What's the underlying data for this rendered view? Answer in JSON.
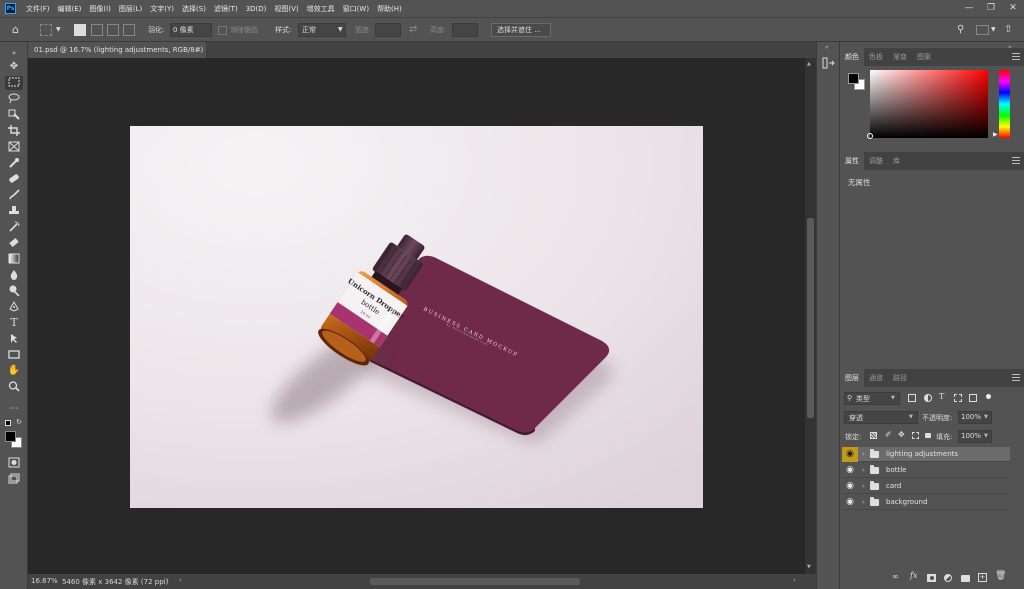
{
  "menubar": {
    "logo": "Ps",
    "items": [
      "文件(F)",
      "编辑(E)",
      "图像(I)",
      "图层(L)",
      "文字(Y)",
      "选择(S)",
      "滤镜(T)",
      "3D(D)",
      "视图(V)",
      "增效工具",
      "窗口(W)",
      "帮助(H)"
    ]
  },
  "options": {
    "feather_label": "羽化:",
    "feather_value": "0 像素",
    "antialias_label": "消除锯齿",
    "style_label": "样式:",
    "style_value": "正常",
    "width_label": "宽度:",
    "height_label": "高度:",
    "select_mask_button": "选择并遮住 ..."
  },
  "document": {
    "tab_title": "01.psd @ 16.7% (lighting adjustments, RGB/8#)",
    "zoom": "16.67%",
    "info": "5460 像素 x 3642 像素 (72 ppi)"
  },
  "artwork": {
    "card_title": "BUSINESS CARD MOCKUP",
    "card_sub": "by mockupplanet.com",
    "bottle_title": "Unicorn Dropper",
    "bottle_sub": "bottle",
    "bottle_small": "10 ml"
  },
  "color_panel": {
    "tabs": [
      "颜色",
      "色板",
      "渐变",
      "图案"
    ],
    "active": 0
  },
  "properties_panel": {
    "tabs": [
      "属性",
      "调整",
      "库"
    ],
    "content": "无属性"
  },
  "layers_panel": {
    "tabs": [
      "图层",
      "通道",
      "路径"
    ],
    "filter_label": "类型",
    "blend_mode": "穿透",
    "opacity_label": "不透明度:",
    "opacity_value": "100%",
    "lock_label": "锁定:",
    "fill_label": "填充:",
    "fill_value": "100%",
    "layers": [
      {
        "name": "lighting adjustments",
        "selected": true
      },
      {
        "name": "bottle",
        "selected": false
      },
      {
        "name": "card",
        "selected": false
      },
      {
        "name": "background",
        "selected": false
      }
    ],
    "footer_icons": [
      "link-icon",
      "fx-icon",
      "mask-icon",
      "adjustment-icon",
      "group-icon",
      "new-layer-icon",
      "trash-icon"
    ]
  },
  "colors": {
    "accent_eye": "#c09a1c",
    "card": "#6e2a48",
    "bottle_cap": "#4e2f3f",
    "bottle_label_band": "#a8336f"
  }
}
